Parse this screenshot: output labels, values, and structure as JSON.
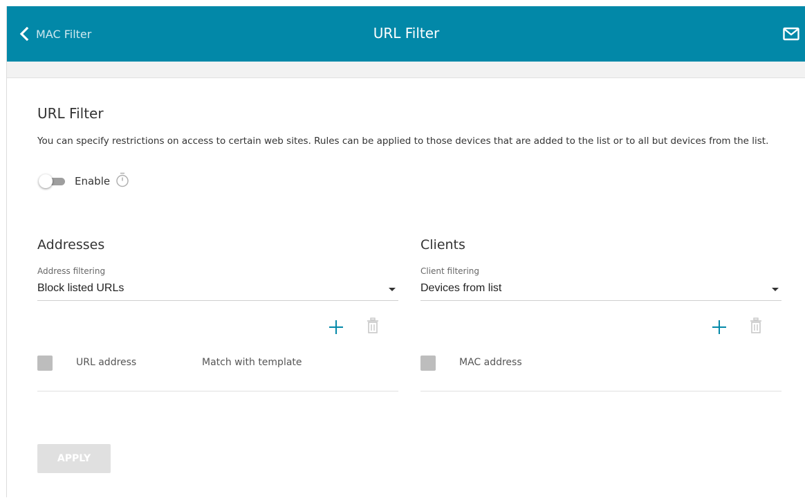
{
  "header": {
    "back_label": "MAC Filter",
    "title": "URL Filter",
    "icons": {
      "back": "chevron-left-icon",
      "mail": "mail-icon"
    }
  },
  "section": {
    "title": "URL Filter",
    "description": "You can specify restrictions on access to certain web sites. Rules can be applied to those devices that are added to the list or to all but devices from the list.",
    "enable_label": "Enable",
    "enabled": false,
    "timer_icon": "timer-icon"
  },
  "addresses": {
    "title": "Addresses",
    "filter_label": "Address filtering",
    "filter_value": "Block listed URLs",
    "columns": [
      "URL address",
      "Match with template"
    ],
    "rows": []
  },
  "clients": {
    "title": "Clients",
    "filter_label": "Client filtering",
    "filter_value": "Devices from list",
    "columns": [
      "MAC address"
    ],
    "rows": []
  },
  "apply_label": "APPLY",
  "colors": {
    "header_bg": "#0288a8",
    "accent": "#0288a8",
    "disabled": "#e0e0e0"
  }
}
